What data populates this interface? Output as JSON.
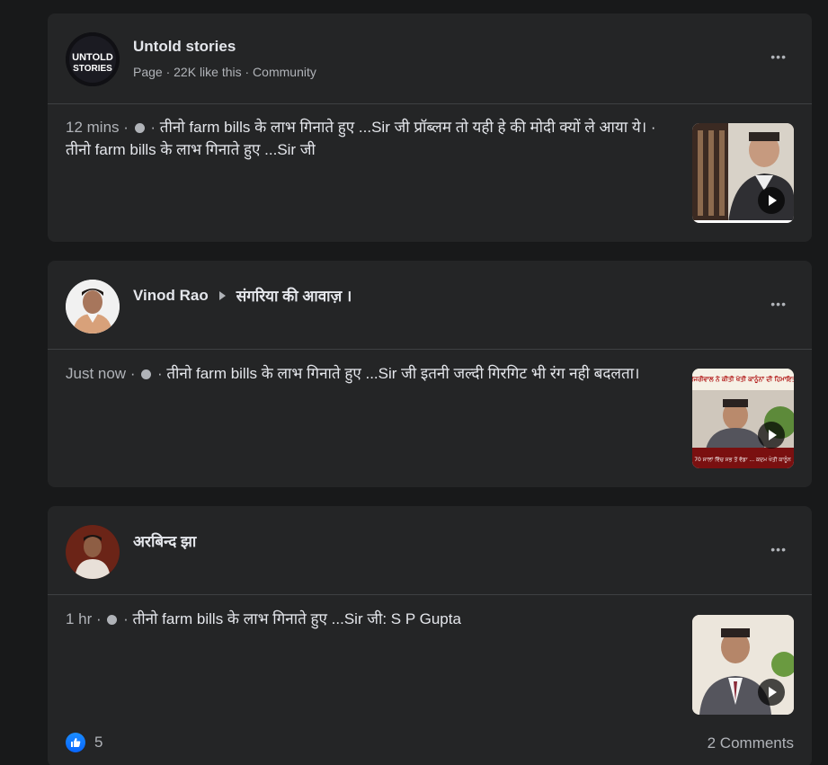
{
  "posts": [
    {
      "author": "Untold stories",
      "subtitle": "Page · 22K like this · Community",
      "avatar_text": "UNTOLD\nSTORIES",
      "time": "12 mins",
      "text": "तीनो farm bills के लाभ गिनाते हुए ...Sir जी प्रॉब्लम तो यही हे की मोदी क्यों ले आया ये। · तीनो farm bills के लाभ गिनाते हुए ...Sir जी",
      "more_label": "•••"
    },
    {
      "author": "Vinod Rao",
      "group": "संगरिया की आवाज़ ।",
      "time": "Just now",
      "text": "तीनो farm bills के लाभ गिनाते हुए ...Sir जी इतनी जल्दी गिरगिट भी रंग नही बदलता।",
      "thumb_caption_top": "ਕੇਜਰੀਵਾਲ ਨੇ ਕੀਤੀ ਖੇਤੀ ਕਾਨੂੰਨਾਂ ਦੀ ਹਿਮਾਇਤ",
      "thumb_caption_bottom": "70 ਸਾਲਾਂ ਵਿੱਚ ਸਭ ਤੋਂ ਵੱਡਾ ... ਕਦਮ ਖੇਤੀ ਕਾਨੂੰਨ",
      "more_label": "•••"
    },
    {
      "author": "अरबिन्द झा",
      "time": "1 hr",
      "text": "तीनो farm bills के लाभ गिनाते हुए ...Sir जी: S P Gupta",
      "likes": "5",
      "comments": "2 Comments",
      "more_label": "•••"
    }
  ],
  "colors": {
    "background": "#18191a",
    "card": "#242526",
    "text_primary": "#e4e6eb",
    "text_secondary": "#b0b3b8",
    "like_blue": "#0866ff"
  }
}
